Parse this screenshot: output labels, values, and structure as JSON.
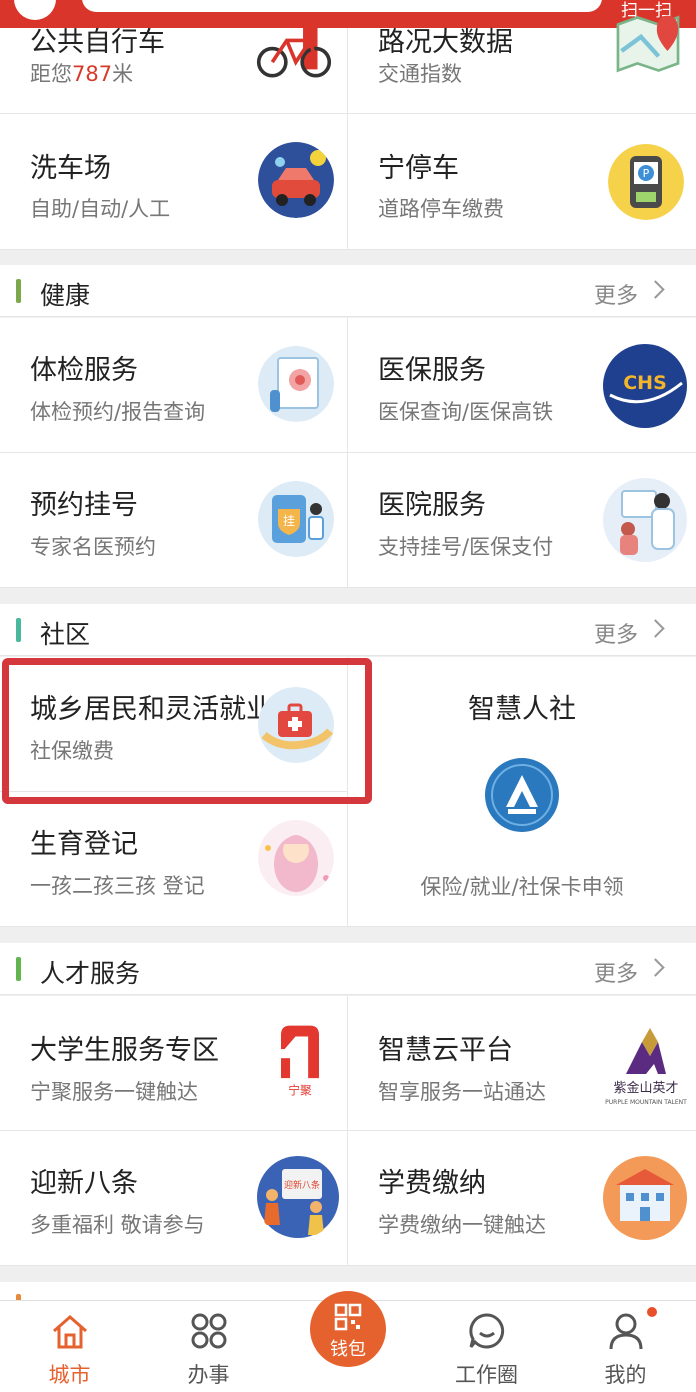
{
  "topbar": {
    "scan": "扫一扫"
  },
  "transport": {
    "row0": [
      {
        "title": "公共自行车",
        "sub_prefix": "距您",
        "sub_value": "787",
        "sub_suffix": "米",
        "icon": "bicycle-icon"
      },
      {
        "title": "路况大数据",
        "sub": "交通指数",
        "icon": "map-icon"
      }
    ],
    "row1": [
      {
        "title": "洗车场",
        "sub": "自助/自动/人工",
        "icon": "car-wash-icon"
      },
      {
        "title": "宁停车",
        "sub": "道路停车缴费",
        "icon": "parking-icon"
      }
    ]
  },
  "health": {
    "title": "健康",
    "more": "更多",
    "items": [
      {
        "title": "体检服务",
        "sub": "体检预约/报告查询",
        "icon": "medical-check-icon"
      },
      {
        "title": "医保服务",
        "sub": "医保查询/医保高铁",
        "icon": "chs-logo-icon"
      },
      {
        "title": "预约挂号",
        "sub": "专家名医预约",
        "icon": "registration-icon"
      },
      {
        "title": "医院服务",
        "sub": "支持挂号/医保支付",
        "icon": "doctor-icon"
      }
    ]
  },
  "community": {
    "title": "社区",
    "more": "更多",
    "items": [
      {
        "title": "城乡居民和灵活就业",
        "sub": "社保缴费",
        "icon": "medical-kit-icon"
      },
      {
        "title": "生育登记",
        "sub": "一孩二孩三孩 登记",
        "icon": "baby-icon"
      }
    ],
    "right": {
      "title": "智慧人社",
      "sub": "保险/就业/社保卡申领",
      "icon": "social-security-logo-icon"
    }
  },
  "talent": {
    "title": "人才服务",
    "more": "更多",
    "items": [
      {
        "title": "大学生服务专区",
        "sub": "宁聚服务一键触达",
        "icon": "ningju-logo-icon",
        "logo_text": "宁聚"
      },
      {
        "title": "智慧云平台",
        "sub": "智享服务一站通达",
        "icon": "purple-mountain-logo-icon",
        "logo_text": "紫金山英才",
        "logo_sub": "PURPLE MOUNTAIN TALENT"
      },
      {
        "title": "迎新八条",
        "sub": "多重福利 敬请参与",
        "icon": "welcome-icon",
        "logo_text": "迎新八条"
      },
      {
        "title": "学费缴纳",
        "sub": "学费缴纳一键触达",
        "icon": "school-icon"
      }
    ]
  },
  "tabbar": {
    "active_color": "#e5622f",
    "tabs": [
      {
        "label": "城市",
        "icon": "home-icon"
      },
      {
        "label": "办事",
        "icon": "grid-icon"
      },
      {
        "label": "钱包",
        "icon": "wallet-qr-icon"
      },
      {
        "label": "工作圈",
        "icon": "chat-icon"
      },
      {
        "label": "我的",
        "icon": "user-icon"
      }
    ]
  },
  "colors": {
    "health_bar": "#7aa84a",
    "community_bar": "#49b89c",
    "talent_bar": "#62b44e",
    "highlight": "#d4373c"
  }
}
